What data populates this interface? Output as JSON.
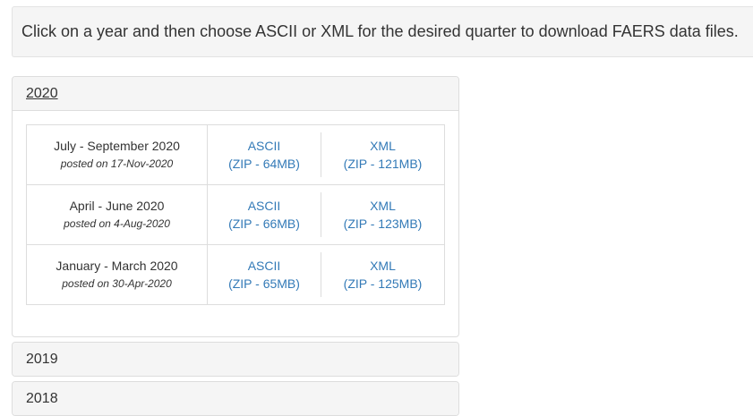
{
  "instructions": "Click on a year and then choose ASCII or XML for the desired quarter to download FAERS data files.",
  "years": [
    {
      "label": "2020",
      "expanded": true,
      "quarters": [
        {
          "name": "July - September 2020",
          "posted": "posted on 17-Nov-2020",
          "ascii": {
            "label": "ASCII",
            "size": "(ZIP - 64MB)"
          },
          "xml": {
            "label": "XML",
            "size": "(ZIP - 121MB)"
          }
        },
        {
          "name": "April - June 2020",
          "posted": "posted on 4-Aug-2020",
          "ascii": {
            "label": "ASCII",
            "size": "(ZIP - 66MB)"
          },
          "xml": {
            "label": "XML",
            "size": "(ZIP - 123MB)"
          }
        },
        {
          "name": "January - March 2020",
          "posted": "posted on 30-Apr-2020",
          "ascii": {
            "label": "ASCII",
            "size": "(ZIP - 65MB)"
          },
          "xml": {
            "label": "XML",
            "size": "(ZIP - 125MB)"
          }
        }
      ]
    },
    {
      "label": "2019",
      "expanded": false
    },
    {
      "label": "2018",
      "expanded": false
    }
  ],
  "colors": {
    "link": "#337ab7",
    "panel_heading_bg": "#f5f5f5",
    "border": "#dddddd",
    "text": "#333333"
  }
}
